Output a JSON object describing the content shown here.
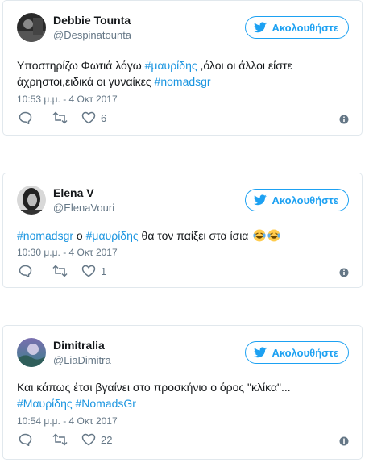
{
  "follow_label": "Ακολουθήστε",
  "accent": "#1da1f2",
  "tweets": [
    {
      "name": "Debbie Tounta",
      "handle": "@Despinatounta",
      "text_before": "Υποστηρίζω Φωτιά λόγω ",
      "tag1": "#μαυρίδης",
      "text_mid": " ,όλοι οι άλλοι είστε άχρηστοι,ειδικά οι γυναίκες ",
      "tag2": "#nomadsgr",
      "time": "10:53 μ.μ. - 4 Οκτ 2017",
      "likes": "6",
      "avatar_icon": "portrait-icon"
    },
    {
      "name": "Elena V",
      "handle": "@ElenaVouri",
      "tag1": "#nomadsgr",
      "text_mid": " ο ",
      "tag2": "#μαυρίδης",
      "text_after": " θα τον παίξει στα ίσια ",
      "emoji": "😂😂",
      "time": "10:30 μ.μ. - 4 Οκτ 2017",
      "likes": "1",
      "avatar_icon": "portrait-icon"
    },
    {
      "name": "Dimitralia",
      "handle": "@LiaDimitra",
      "text_line1": "Και κάπως έτσι βγαίνει στο προσκήνιο ο όρος \"κλίκα\"...",
      "tag1": "#Μαυρίδης",
      "tag2": "#NomadsGr",
      "time": "10:54 μ.μ. - 4 Οκτ 2017",
      "likes": "22",
      "avatar_icon": "landscape-icon"
    }
  ]
}
